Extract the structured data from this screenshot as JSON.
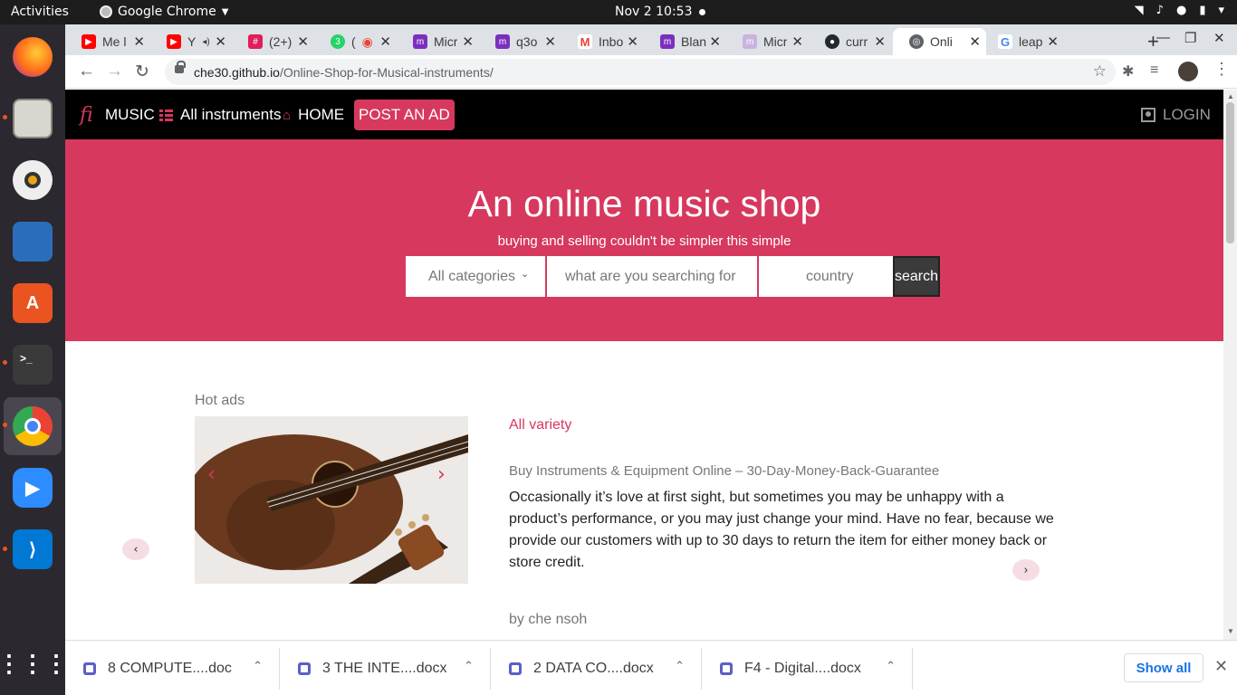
{
  "system": {
    "activities": "Activities",
    "app_name": "Google Chrome",
    "clock": "Nov 2  10:53"
  },
  "dock": {
    "items": [
      "firefox-icon",
      "files-icon",
      "rhythmbox-icon",
      "writer-icon",
      "software-icon",
      "terminal-icon",
      "chrome-icon",
      "zoom-icon",
      "vscode-icon",
      "app-grid-icon"
    ]
  },
  "browser": {
    "tabs": [
      {
        "label": "Me l",
        "color": "#ff0000"
      },
      {
        "label": "Y",
        "color": "#ff0000"
      },
      {
        "label": "(2+)",
        "color": "#e01e5a"
      },
      {
        "label": "(",
        "color": "#25d366"
      },
      {
        "label": "Micr",
        "color": "#7b2fbf"
      },
      {
        "label": "q3o",
        "color": "#7b2fbf"
      },
      {
        "label": "Inbo",
        "color": "#ea4335"
      },
      {
        "label": "Blan",
        "color": "#7b2fbf"
      },
      {
        "label": "Micr",
        "color": "#7b2fbf"
      },
      {
        "label": "curr",
        "color": "#24292e"
      },
      {
        "label": "Onli",
        "color": "#5f6368"
      },
      {
        "label": "leap",
        "color": "#4285f4"
      }
    ],
    "url_host": "che30.github.io",
    "url_path": "/Online-Shop-for-Musical-instruments/"
  },
  "site": {
    "logo": "fi",
    "nav": {
      "music": "MUSIC",
      "all_instruments": "All instruments",
      "home": "HOME",
      "post_ad": "POST AN AD",
      "login": "LOGIN"
    },
    "hero": {
      "title": "An online music shop",
      "subtitle": "buying and selling couldn't be simpler this simple",
      "category_value": "All categories",
      "search_placeholder": "what are you searching for",
      "country_placeholder": "country",
      "search_button": "search"
    },
    "hot": {
      "title": "Hot ads",
      "variety": "All variety",
      "guarantee": "Buy Instruments & Equipment Online – 30-Day-Money-Back-Guarantee",
      "description": "Occasionally it’s love at first sight, but sometimes you may be unhappy with a product’s performance, or you may just change your mind. Have no fear, because we provide our customers with up to 30 days to return the item for either money back or store credit.",
      "author": "by che nsoh"
    }
  },
  "downloads": {
    "items": [
      "8 COMPUTE....doc",
      "3 THE INTE....docx",
      "2 DATA CO....docx",
      "F4 - Digital....docx"
    ],
    "show_all": "Show all"
  }
}
